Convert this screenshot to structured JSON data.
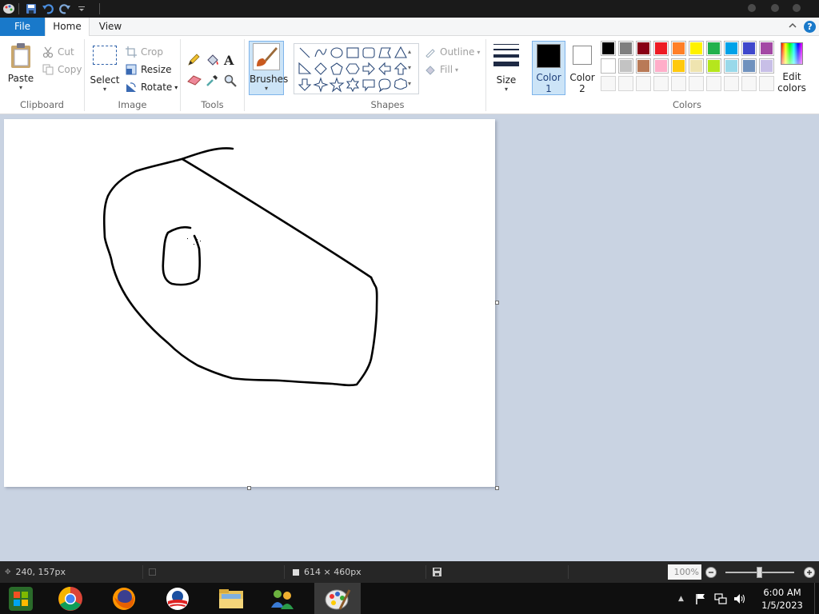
{
  "ribbon_tabs": {
    "file": "File",
    "home": "Home",
    "view": "View"
  },
  "help": "?",
  "clipboard": {
    "paste": "Paste",
    "cut": "Cut",
    "copy": "Copy",
    "label": "Clipboard"
  },
  "image": {
    "select": "Select",
    "crop": "Crop",
    "resize": "Resize",
    "rotate": "Rotate",
    "label": "Image"
  },
  "tools": {
    "label": "Tools"
  },
  "brushes": {
    "label": "Brushes"
  },
  "shapes": {
    "outline": "Outline",
    "fill": "Fill",
    "label": "Shapes"
  },
  "size": {
    "label": "Size"
  },
  "color1": {
    "line1": "Color",
    "line2": "1",
    "value": "#000000"
  },
  "color2": {
    "line1": "Color",
    "line2": "2",
    "value": "#ffffff"
  },
  "colors": {
    "label": "Colors",
    "row1": [
      "#000000",
      "#7f7f7f",
      "#880015",
      "#ed1c24",
      "#ff7f27",
      "#fff200",
      "#22b14c",
      "#00a2e8",
      "#3f48cc",
      "#a349a4"
    ],
    "row2": [
      "#ffffff",
      "#c3c3c3",
      "#b97a57",
      "#ffaec9",
      "#ffc90e",
      "#efe4b0",
      "#b5e61d",
      "#99d9ea",
      "#7092be",
      "#c8bfe7"
    ],
    "row3": [
      "",
      "",
      "",
      "",
      "",
      "",
      "",
      "",
      "",
      ""
    ]
  },
  "edit_colors": {
    "line1": "Edit",
    "line2": "colors"
  },
  "status": {
    "cursor_pos": "240, 157px",
    "canvas_size": "614 × 460px",
    "zoom": "100%"
  },
  "clock": {
    "time": "6:00 AM",
    "date": "1/5/2023"
  },
  "taskbar_apps": [
    "windows-media-center-icon",
    "chrome-icon",
    "firefox-icon",
    "obama-logo-icon",
    "file-explorer-icon",
    "network-people-icon",
    "paint-icon"
  ]
}
